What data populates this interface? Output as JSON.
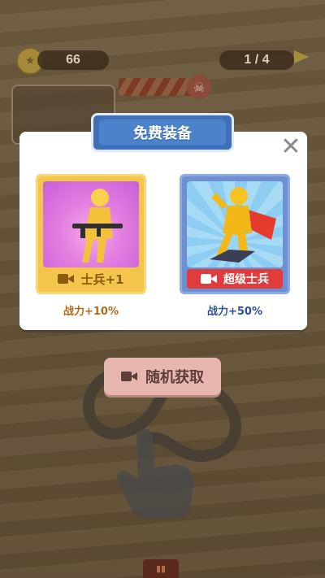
{
  "hud": {
    "coins": "66",
    "level": "1 / 4"
  },
  "modal": {
    "title": "免费装备",
    "close_symbol": "✕"
  },
  "cards": [
    {
      "label": "士兵+1",
      "power": "战力+10%",
      "icon": "video-icon"
    },
    {
      "label": "超级士兵",
      "power": "战力+50%",
      "icon": "video-icon"
    }
  ],
  "random_button": {
    "label": "随机获取",
    "icon": "video-icon"
  },
  "colors": {
    "title_blue": "#4a82cc",
    "card_gold": "#f3c64b",
    "card_blue": "#6f8fd3",
    "super_red": "#e23b3b",
    "random_pink": "#e7b6ae"
  }
}
